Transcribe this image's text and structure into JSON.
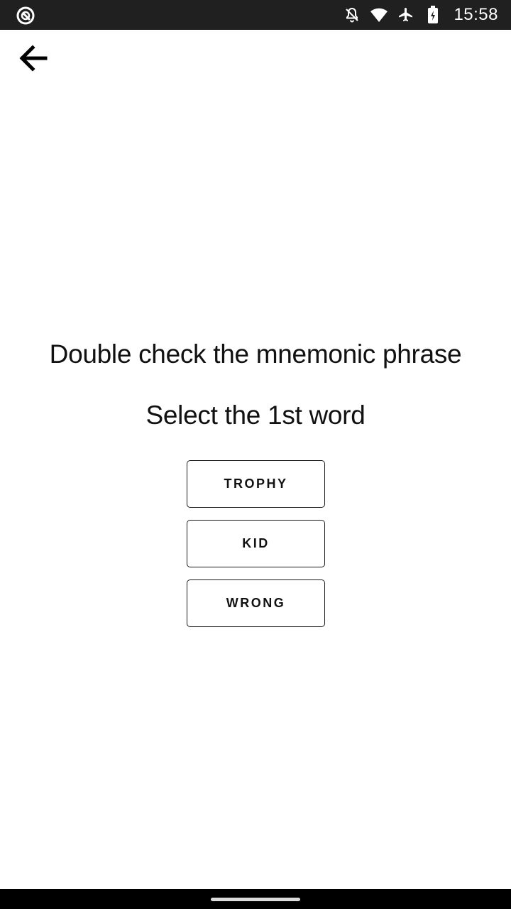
{
  "status_bar": {
    "time": "15:58",
    "icons": [
      "app-notification-icon",
      "bell-off-icon",
      "wifi-icon",
      "airplane-icon",
      "battery-charging-icon"
    ]
  },
  "header": {
    "back_icon": "arrow-left-icon"
  },
  "main": {
    "title": "Double check the mnemonic phrase",
    "subtitle": "Select the 1st word",
    "options": [
      {
        "label": "TROPHY"
      },
      {
        "label": "KID"
      },
      {
        "label": "WRONG"
      }
    ]
  },
  "colors": {
    "status_bar_bg": "#202020",
    "page_bg": "#ffffff",
    "text": "#111111",
    "nav_bar_bg": "#000000"
  }
}
